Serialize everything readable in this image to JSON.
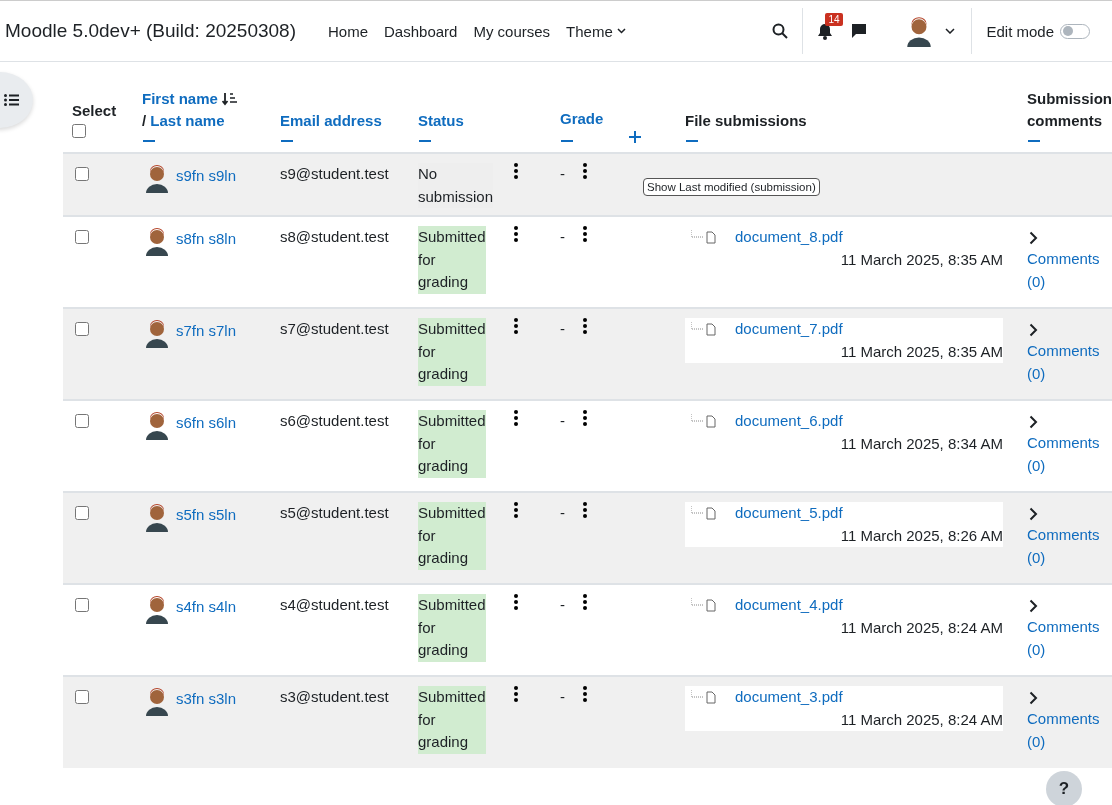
{
  "navbar": {
    "site_name": "Moodle 5.0dev+ (Build: 20250308)",
    "links": [
      {
        "label": "Home",
        "dropdown": false
      },
      {
        "label": "Dashboard",
        "dropdown": false
      },
      {
        "label": "My courses",
        "dropdown": false
      },
      {
        "label": "Theme",
        "dropdown": true
      }
    ],
    "notification_count": "14",
    "edit_mode": {
      "label": "Edit mode",
      "on": false
    }
  },
  "table": {
    "columns": {
      "select": "Select",
      "first_name": "First name",
      "separator": "/",
      "last_name": "Last name",
      "email": "Email address",
      "status": "Status",
      "grade": "Grade",
      "files": "File submissions",
      "comments": "Submission comments"
    },
    "select_all_checked": false,
    "tooltip": "Show Last modified (submission)",
    "rows": [
      {
        "checked": false,
        "name": "s9fn s9ln",
        "email": "s9@student.test",
        "status": "No submission",
        "submitted": false,
        "grade": "-"
      },
      {
        "checked": false,
        "name": "s8fn s8ln",
        "email": "s8@student.test",
        "status": "Submitted for grading",
        "submitted": true,
        "grade": "-",
        "file": "document_8.pdf",
        "date": "11 March 2025, 8:35 AM",
        "comments": "Comments (0)"
      },
      {
        "checked": false,
        "name": "s7fn s7ln",
        "email": "s7@student.test",
        "status": "Submitted for grading",
        "submitted": true,
        "grade": "-",
        "file": "document_7.pdf",
        "date": "11 March 2025, 8:35 AM",
        "comments": "Comments (0)"
      },
      {
        "checked": false,
        "name": "s6fn s6ln",
        "email": "s6@student.test",
        "status": "Submitted for grading",
        "submitted": true,
        "grade": "-",
        "file": "document_6.pdf",
        "date": "11 March 2025, 8:34 AM",
        "comments": "Comments (0)"
      },
      {
        "checked": false,
        "name": "s5fn s5ln",
        "email": "s5@student.test",
        "status": "Submitted for grading",
        "submitted": true,
        "grade": "-",
        "file": "document_5.pdf",
        "date": "11 March 2025, 8:26 AM",
        "comments": "Comments (0)"
      },
      {
        "checked": false,
        "name": "s4fn s4ln",
        "email": "s4@student.test",
        "status": "Submitted for grading",
        "submitted": true,
        "grade": "-",
        "file": "document_4.pdf",
        "date": "11 March 2025, 8:24 AM",
        "comments": "Comments (0)"
      },
      {
        "checked": false,
        "name": "s3fn s3ln",
        "email": "s3@student.test",
        "status": "Submitted for grading",
        "submitted": true,
        "grade": "-",
        "file": "document_3.pdf",
        "date": "11 March 2025, 8:24 AM",
        "comments": "Comments (0)"
      }
    ]
  },
  "help_button": "?"
}
